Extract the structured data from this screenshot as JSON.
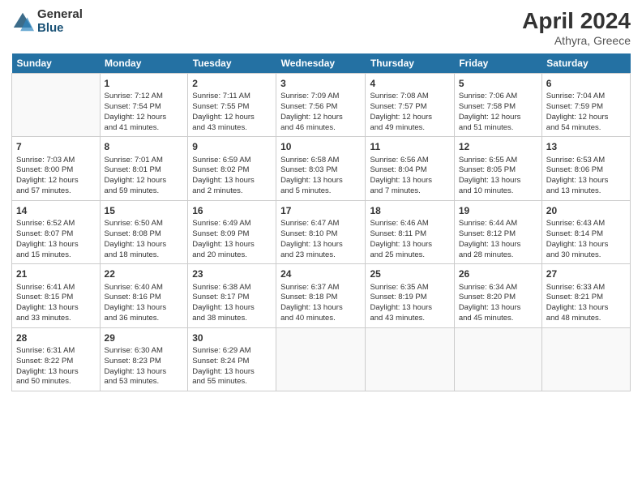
{
  "logo": {
    "general": "General",
    "blue": "Blue"
  },
  "title": "April 2024",
  "location": "Athyra, Greece",
  "days_of_week": [
    "Sunday",
    "Monday",
    "Tuesday",
    "Wednesday",
    "Thursday",
    "Friday",
    "Saturday"
  ],
  "weeks": [
    [
      {
        "day": "",
        "info": ""
      },
      {
        "day": "1",
        "info": "Sunrise: 7:12 AM\nSunset: 7:54 PM\nDaylight: 12 hours\nand 41 minutes."
      },
      {
        "day": "2",
        "info": "Sunrise: 7:11 AM\nSunset: 7:55 PM\nDaylight: 12 hours\nand 43 minutes."
      },
      {
        "day": "3",
        "info": "Sunrise: 7:09 AM\nSunset: 7:56 PM\nDaylight: 12 hours\nand 46 minutes."
      },
      {
        "day": "4",
        "info": "Sunrise: 7:08 AM\nSunset: 7:57 PM\nDaylight: 12 hours\nand 49 minutes."
      },
      {
        "day": "5",
        "info": "Sunrise: 7:06 AM\nSunset: 7:58 PM\nDaylight: 12 hours\nand 51 minutes."
      },
      {
        "day": "6",
        "info": "Sunrise: 7:04 AM\nSunset: 7:59 PM\nDaylight: 12 hours\nand 54 minutes."
      }
    ],
    [
      {
        "day": "7",
        "info": "Sunrise: 7:03 AM\nSunset: 8:00 PM\nDaylight: 12 hours\nand 57 minutes."
      },
      {
        "day": "8",
        "info": "Sunrise: 7:01 AM\nSunset: 8:01 PM\nDaylight: 12 hours\nand 59 minutes."
      },
      {
        "day": "9",
        "info": "Sunrise: 6:59 AM\nSunset: 8:02 PM\nDaylight: 13 hours\nand 2 minutes."
      },
      {
        "day": "10",
        "info": "Sunrise: 6:58 AM\nSunset: 8:03 PM\nDaylight: 13 hours\nand 5 minutes."
      },
      {
        "day": "11",
        "info": "Sunrise: 6:56 AM\nSunset: 8:04 PM\nDaylight: 13 hours\nand 7 minutes."
      },
      {
        "day": "12",
        "info": "Sunrise: 6:55 AM\nSunset: 8:05 PM\nDaylight: 13 hours\nand 10 minutes."
      },
      {
        "day": "13",
        "info": "Sunrise: 6:53 AM\nSunset: 8:06 PM\nDaylight: 13 hours\nand 13 minutes."
      }
    ],
    [
      {
        "day": "14",
        "info": "Sunrise: 6:52 AM\nSunset: 8:07 PM\nDaylight: 13 hours\nand 15 minutes."
      },
      {
        "day": "15",
        "info": "Sunrise: 6:50 AM\nSunset: 8:08 PM\nDaylight: 13 hours\nand 18 minutes."
      },
      {
        "day": "16",
        "info": "Sunrise: 6:49 AM\nSunset: 8:09 PM\nDaylight: 13 hours\nand 20 minutes."
      },
      {
        "day": "17",
        "info": "Sunrise: 6:47 AM\nSunset: 8:10 PM\nDaylight: 13 hours\nand 23 minutes."
      },
      {
        "day": "18",
        "info": "Sunrise: 6:46 AM\nSunset: 8:11 PM\nDaylight: 13 hours\nand 25 minutes."
      },
      {
        "day": "19",
        "info": "Sunrise: 6:44 AM\nSunset: 8:12 PM\nDaylight: 13 hours\nand 28 minutes."
      },
      {
        "day": "20",
        "info": "Sunrise: 6:43 AM\nSunset: 8:14 PM\nDaylight: 13 hours\nand 30 minutes."
      }
    ],
    [
      {
        "day": "21",
        "info": "Sunrise: 6:41 AM\nSunset: 8:15 PM\nDaylight: 13 hours\nand 33 minutes."
      },
      {
        "day": "22",
        "info": "Sunrise: 6:40 AM\nSunset: 8:16 PM\nDaylight: 13 hours\nand 36 minutes."
      },
      {
        "day": "23",
        "info": "Sunrise: 6:38 AM\nSunset: 8:17 PM\nDaylight: 13 hours\nand 38 minutes."
      },
      {
        "day": "24",
        "info": "Sunrise: 6:37 AM\nSunset: 8:18 PM\nDaylight: 13 hours\nand 40 minutes."
      },
      {
        "day": "25",
        "info": "Sunrise: 6:35 AM\nSunset: 8:19 PM\nDaylight: 13 hours\nand 43 minutes."
      },
      {
        "day": "26",
        "info": "Sunrise: 6:34 AM\nSunset: 8:20 PM\nDaylight: 13 hours\nand 45 minutes."
      },
      {
        "day": "27",
        "info": "Sunrise: 6:33 AM\nSunset: 8:21 PM\nDaylight: 13 hours\nand 48 minutes."
      }
    ],
    [
      {
        "day": "28",
        "info": "Sunrise: 6:31 AM\nSunset: 8:22 PM\nDaylight: 13 hours\nand 50 minutes."
      },
      {
        "day": "29",
        "info": "Sunrise: 6:30 AM\nSunset: 8:23 PM\nDaylight: 13 hours\nand 53 minutes."
      },
      {
        "day": "30",
        "info": "Sunrise: 6:29 AM\nSunset: 8:24 PM\nDaylight: 13 hours\nand 55 minutes."
      },
      {
        "day": "",
        "info": ""
      },
      {
        "day": "",
        "info": ""
      },
      {
        "day": "",
        "info": ""
      },
      {
        "day": "",
        "info": ""
      }
    ]
  ]
}
